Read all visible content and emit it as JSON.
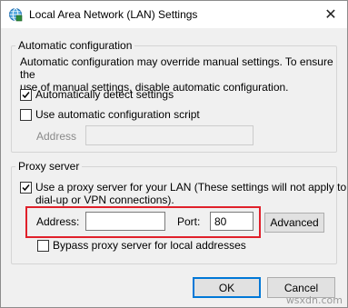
{
  "window": {
    "title": "Local Area Network (LAN) Settings",
    "close_glyph": "✕"
  },
  "auto_config": {
    "legend": "Automatic configuration",
    "description_line1": "Automatic configuration may override manual settings. To ensure the",
    "description_line2": "use of manual settings, disable automatic configuration.",
    "detect_label": "Automatically detect settings",
    "detect_checked": true,
    "script_label": "Use automatic configuration script",
    "script_checked": false,
    "address_label": "Address",
    "address_value": ""
  },
  "proxy": {
    "legend": "Proxy server",
    "use_proxy_line1": "Use a proxy server for your LAN (These settings will not apply to",
    "use_proxy_line2": "dial-up or VPN connections).",
    "use_proxy_checked": true,
    "address_label": "Address:",
    "address_value": "",
    "port_label": "Port:",
    "port_value": "80",
    "advanced_label": "Advanced",
    "bypass_label": "Bypass proxy server for local addresses",
    "bypass_checked": false
  },
  "footer": {
    "ok_label": "OK",
    "cancel_label": "Cancel"
  },
  "watermark": "wsxdn.com",
  "colors": {
    "highlight": "#e0202a",
    "default_button_border": "#0078d7"
  }
}
